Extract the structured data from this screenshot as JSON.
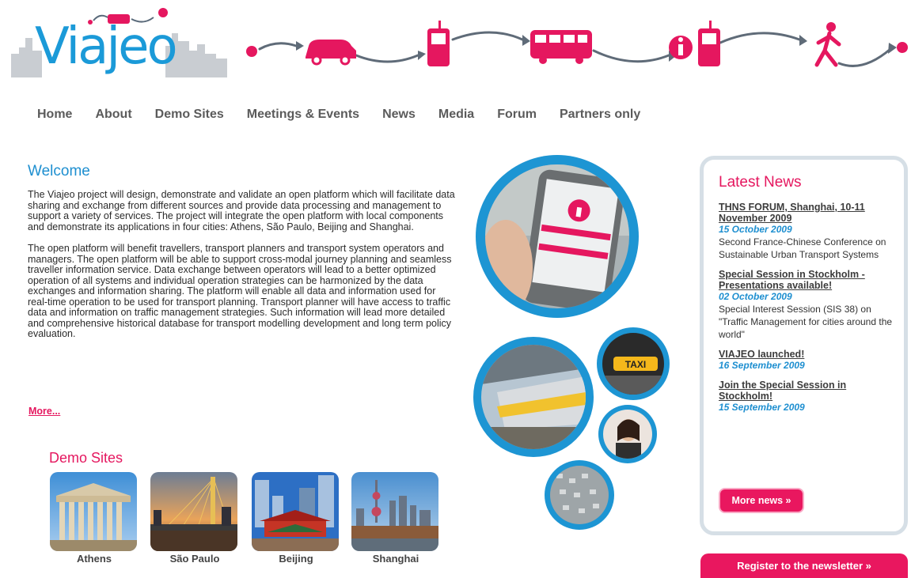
{
  "logo": {
    "text": "Viajeo"
  },
  "journey": {
    "icons": [
      "car-icon",
      "mobile-phone-icon",
      "bus-icon",
      "info-icon",
      "walking-person-icon"
    ]
  },
  "nav": {
    "items": [
      "Home",
      "About",
      "Demo Sites",
      "Meetings & Events",
      "News",
      "Media",
      "Forum",
      "Partners only"
    ]
  },
  "welcome": {
    "title": "Welcome",
    "paragraphs": [
      "The Viajeo project will design, demonstrate and validate an open platform which will facilitate data sharing and exchange from different sources and provide data processing and management to support a variety of services. The project will integrate the open platform with local components and demonstrate its applications in four cities: Athens, São Paulo, Beijing and Shanghai.",
      "The open platform will benefit travellers, transport planners and transport system operators and managers. The open platform will be able to support cross-modal journey planning and seamless traveller information service. Data exchange between operators will lead to a better optimized operation of all systems and individual operation strategies can be harmonized by the data exchanges and information sharing. The platform will enable all data and information used for real-time operation to be used for transport planning. Transport planner will have access to traffic data and information on traffic management strategies. Such information will lead more detailed and comprehensive historical database for transport modelling development and long term policy evaluation."
    ],
    "more_link": "More..."
  },
  "demo_sites": {
    "title": "Demo Sites",
    "sites": [
      {
        "name": "Athens"
      },
      {
        "name": "São Paulo"
      },
      {
        "name": "Beijing"
      },
      {
        "name": "Shanghai"
      }
    ]
  },
  "latest_news": {
    "title": "Latest News",
    "items": [
      {
        "headline": "THNS FORUM, Shanghai, 10-11 November 2009",
        "date": "15 October 2009",
        "summary": "Second France-Chinese Conference on Sustainable Urban Transport Systems"
      },
      {
        "headline": "Special Session in Stockholm - Presentations available!",
        "date": "02 October 2009",
        "summary": "Special Interest Session (SIS 38) on \"Traffic Management for cities around the world\""
      },
      {
        "headline": "VIAJEO launched!",
        "date": "16 September 2009",
        "summary": ""
      },
      {
        "headline": "Join the Special Session in Stockholm!",
        "date": "15 September 2009",
        "summary": ""
      }
    ],
    "more_button": "More news »"
  },
  "newsletter_button": "Register to the newsletter »",
  "phone_screen_text": {
    "taxi_sign": "TAXI"
  },
  "colors": {
    "brand_blue": "#1b9ad8",
    "accent_pink": "#e5175f",
    "nav_text": "#5b5b5b",
    "box_border": "#d6dfe6"
  }
}
